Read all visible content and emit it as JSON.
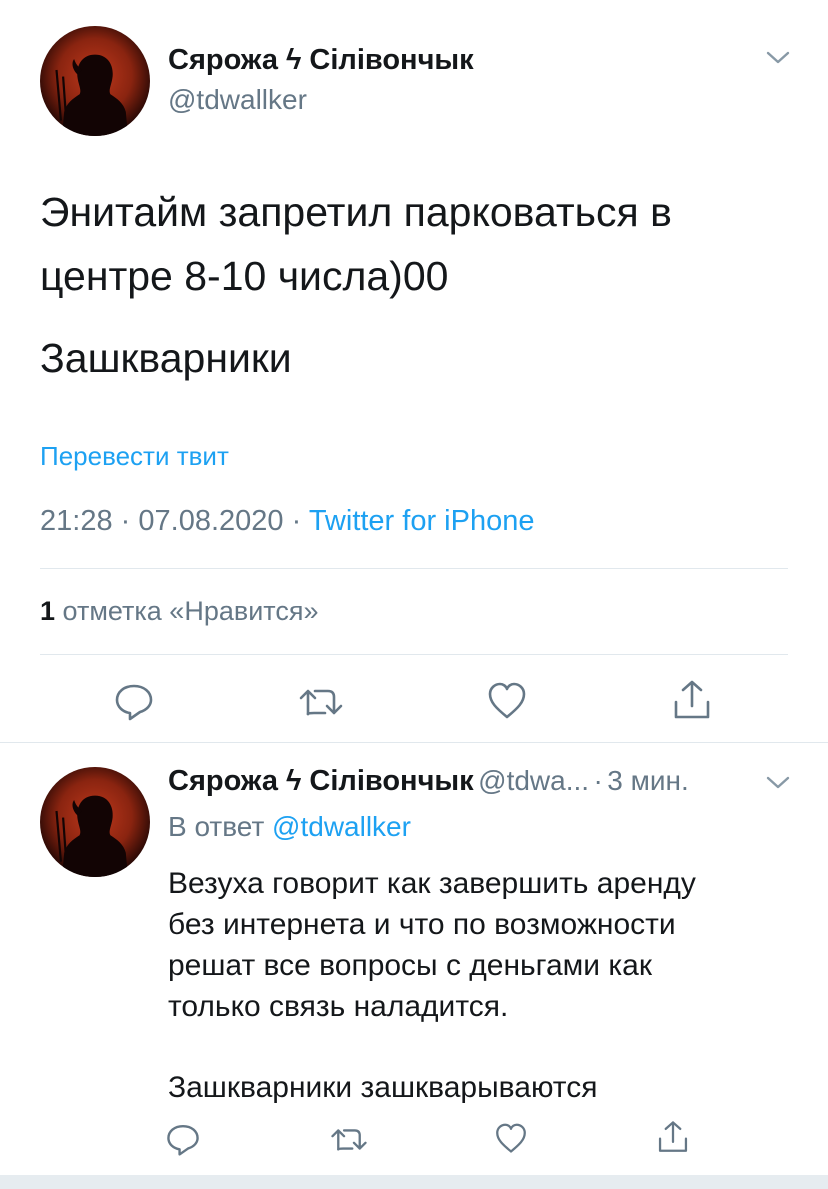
{
  "main_tweet": {
    "author_name": "Сярожа ϟ Сілівончык",
    "author_handle": "@tdwallker",
    "text_line_1": "Энитайм запретил парковаться в",
    "text_line_2": "центре 8-10 числа)00",
    "text_line_3": "Зашкварники",
    "translate_label": "Перевести твит",
    "time": "21:28",
    "separator": "·",
    "date": "07.08.2020",
    "client": "Twitter for iPhone",
    "likes_count": "1",
    "likes_label": "отметка «Нравится»"
  },
  "reply_tweet": {
    "author_name": "Сярожа ϟ Сілівончык",
    "author_handle_truncated": "@tdwa...",
    "separator": "·",
    "time_ago": "3 мин.",
    "reply_prefix": "В ответ",
    "reply_to": "@tdwallker",
    "text_line_1": "Везуха говорит как завершить аренду",
    "text_line_2": "без интернета и что по возможности",
    "text_line_3": "решат все вопросы с деньгами как",
    "text_line_4": "только связь наладится.",
    "text_line_5": "Зашкварники зашкварываются"
  },
  "icons": {
    "menu": "chevron-down-icon",
    "reply": "reply-icon",
    "retweet": "retweet-icon",
    "like": "heart-icon",
    "share": "share-icon"
  },
  "colors": {
    "link": "#1da1f2",
    "secondary_text": "#657786",
    "divider": "#e1e8ed"
  }
}
